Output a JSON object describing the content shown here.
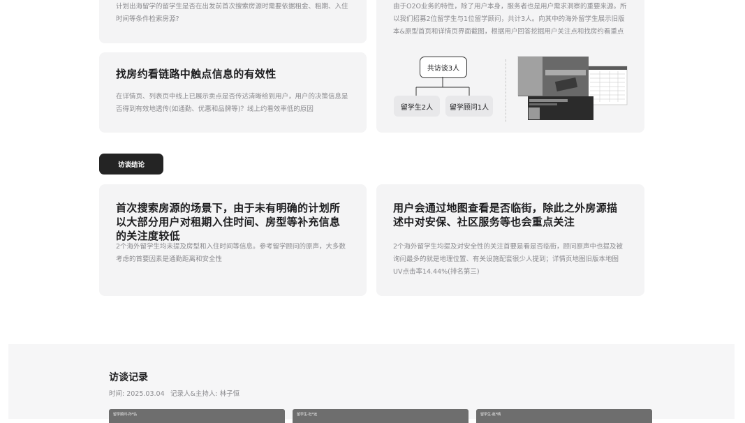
{
  "cards": {
    "top_left_partial": {
      "desc": "计划出海留学的留学生是否在出发前首次搜索房源时需要依据租金、租期、入住时间等条件检索房源?"
    },
    "effectiveness": {
      "title": "找房约看链路中触点信息的有效性",
      "desc": "在详情页、列表页中线上已展示卖点是否传达清晰给到用户，用户的决策信息是否得到有效地透传(如通勤、优惠和品牌等)？线上约看效率低的原因"
    },
    "method": {
      "desc": "由于O2O业务的特性，除了用户本身，服务者也是用户需求洞察的重要来源。所以我们招募2位留学生与1位留学顾问，共计3人。向其中的海外留学生展示旧版本&原型首页和详情页界面截图，根据用户回答挖掘用户关注点和找房约看重点",
      "diagram": {
        "root": "共访谈3人",
        "left": "留学生2人",
        "right": "留学顾问1人"
      }
    }
  },
  "conclusion_button": "访谈结论",
  "conclusions": [
    {
      "title": "首次搜索房源的场景下，由于未有明确的计划所以大部分用户对租期入住时间、房型等补充信息的关注度较低",
      "desc": "2个海外留学生均未提及房型和入住时间等信息。参考留学顾问的原声，大多数考虑的首要因素是通勤距离和安全性"
    },
    {
      "title": "用户会通过地图查看是否临街，除此之外房源描述中对安保、社区服务等也会重点关注",
      "desc": "2个海外留学生均提及对安全性的关注首要是看是否临街，顾问原声中也提及被询问最多的就是地理位置、有关设施配套很少人提到；详情页地图旧版本地图UV点击率14.44%(排名第三)"
    }
  ],
  "record": {
    "title": "访谈记录",
    "time": "时间: 2025.03.04",
    "recorder": "记录人&主持人: 林子恒",
    "videos": [
      {
        "label": "留学顾问-孙*弘"
      },
      {
        "label": "留学生-杜*远"
      },
      {
        "label": "留学生-赵*晴"
      }
    ]
  }
}
